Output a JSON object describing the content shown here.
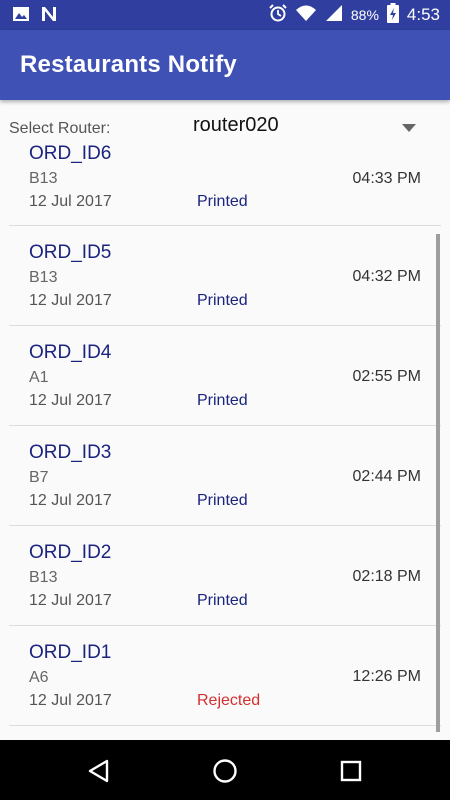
{
  "status_bar": {
    "battery": "88%",
    "time": "4:53",
    "icons": [
      "image-icon",
      "n-notification-icon",
      "alarm-icon",
      "wifi-icon",
      "signal-icon",
      "battery-charging-icon"
    ]
  },
  "app_bar": {
    "title": "Restaurants Notify"
  },
  "router": {
    "label": "Select Router:",
    "selected": "router020"
  },
  "orders": [
    {
      "id": "ORD_ID6",
      "table": "B13",
      "date": "12 Jul 2017",
      "status": "Printed",
      "time": "04:33 PM"
    },
    {
      "id": "ORD_ID5",
      "table": "B13",
      "date": "12 Jul 2017",
      "status": "Printed",
      "time": "04:32 PM"
    },
    {
      "id": "ORD_ID4",
      "table": "A1",
      "date": "12 Jul 2017",
      "status": "Printed",
      "time": "02:55 PM"
    },
    {
      "id": "ORD_ID3",
      "table": "B7",
      "date": "12 Jul 2017",
      "status": "Printed",
      "time": "02:44 PM"
    },
    {
      "id": "ORD_ID2",
      "table": "B13",
      "date": "12 Jul 2017",
      "status": "Printed",
      "time": "02:18 PM"
    },
    {
      "id": "ORD_ID1",
      "table": "A6",
      "date": "12 Jul 2017",
      "status": "Rejected",
      "time": "12:26 PM"
    }
  ],
  "colors": {
    "primary": "#3f51b5",
    "primary_dark": "#303f9f",
    "order_id": "#1a237e",
    "printed": "#1a237e",
    "rejected": "#d32f2f"
  },
  "nav_bar": {
    "icons": [
      "back-icon",
      "home-icon",
      "recents-icon"
    ]
  }
}
